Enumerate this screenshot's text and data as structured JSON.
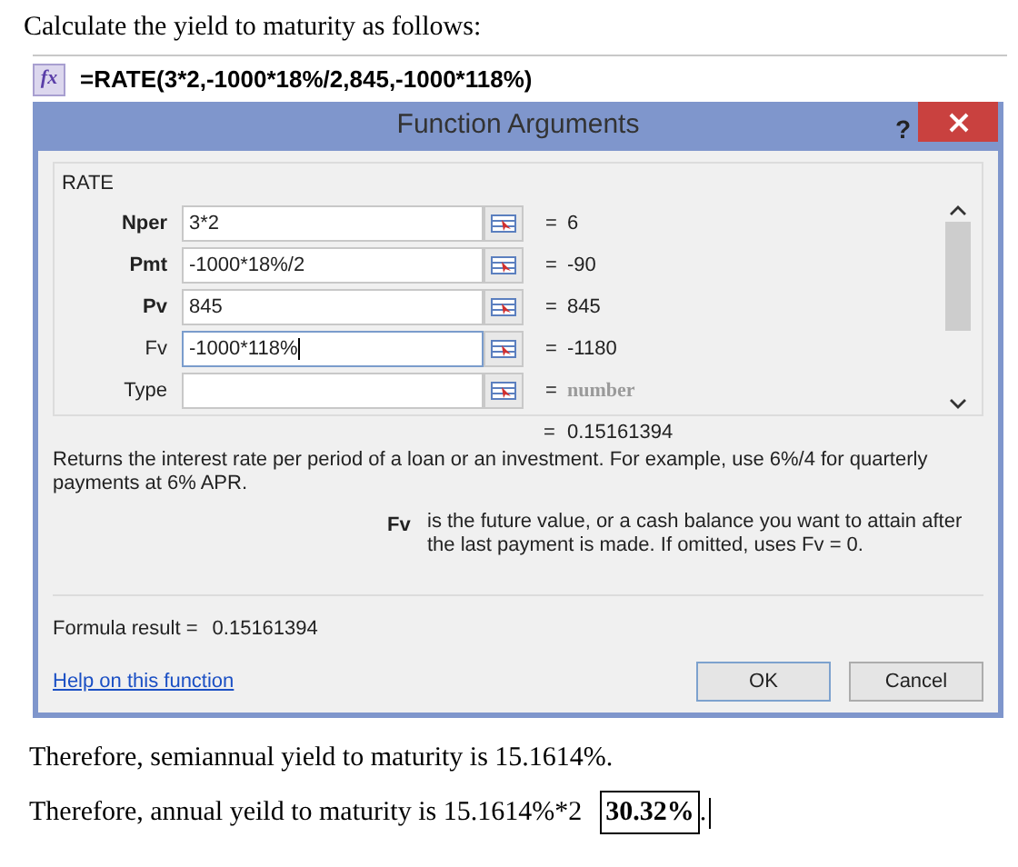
{
  "intro": "Calculate the yield to maturity as follows:",
  "formula_bar": {
    "icon": "fx",
    "formula": "=RATE(3*2,-1000*18%/2,845,-1000*118%)"
  },
  "dialog": {
    "title": "Function Arguments",
    "help": "?",
    "group": "RATE",
    "arguments": [
      {
        "name": "Nper",
        "required": true,
        "value": "3*2",
        "result": "6",
        "hint": false,
        "focused": false
      },
      {
        "name": "Pmt",
        "required": true,
        "value": "-1000*18%/2",
        "result": "-90",
        "hint": false,
        "focused": false
      },
      {
        "name": "Pv",
        "required": true,
        "value": "845",
        "result": "845",
        "hint": false,
        "focused": false
      },
      {
        "name": "Fv",
        "required": false,
        "value": "-1000*118%",
        "result": "-1180",
        "hint": false,
        "focused": true
      },
      {
        "name": "Type",
        "required": false,
        "result": "number",
        "hint": true,
        "focused": false
      }
    ],
    "equals": "=",
    "function_result": "0.15161394",
    "description": "Returns the interest rate per period of a loan or an investment. For example, use 6%/4 for quarterly payments at 6% APR.",
    "argument_help": {
      "name": "Fv",
      "text": "is the future value, or a cash balance you want to attain after the last payment is made. If omitted, uses Fv = 0."
    },
    "formula_result_label": "Formula result =",
    "formula_result": "0.15161394",
    "help_link": "Help on this function",
    "buttons": [
      "OK",
      "Cancel"
    ]
  },
  "conclusions": [
    {
      "text": "Therefore, semiannual yield to maturity is 15.1614%."
    },
    {
      "text": "Therefore, annual yeild to maturity is 15.1614%*2",
      "boxed": "30.32%",
      "after": "."
    }
  ]
}
